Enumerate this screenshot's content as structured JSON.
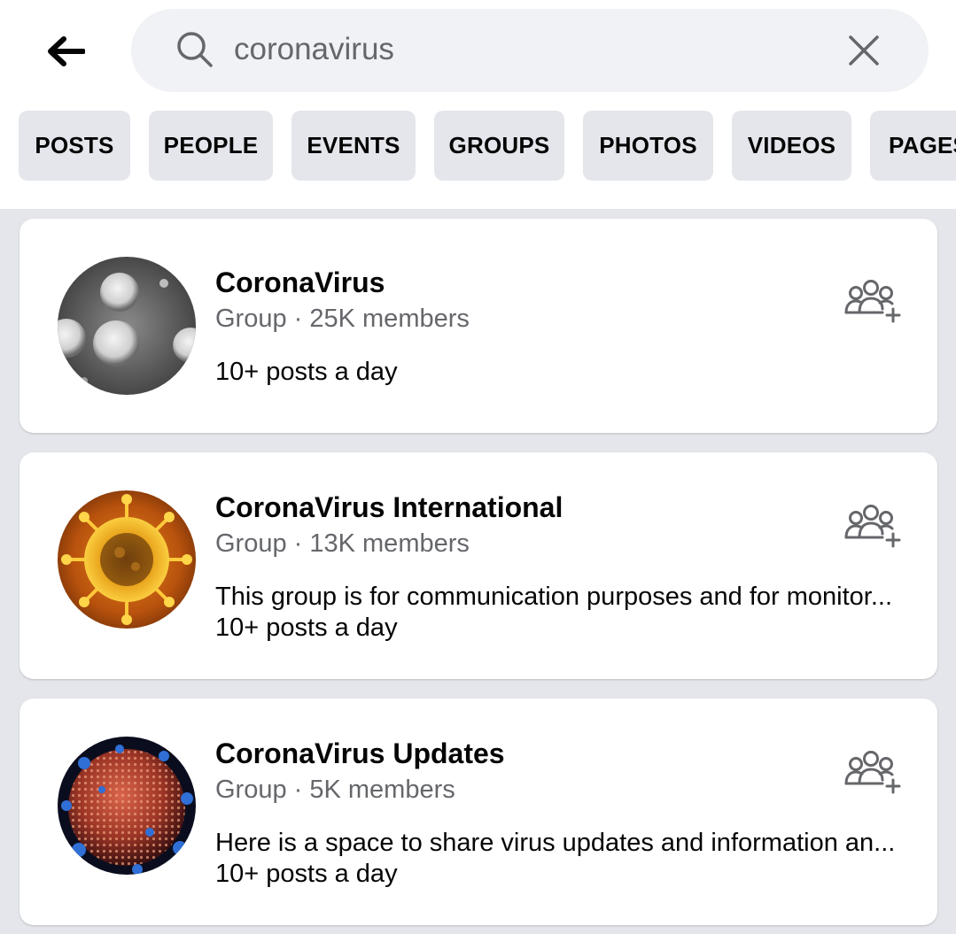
{
  "search": {
    "query": "coronavirus"
  },
  "icons": {
    "back": "back-arrow-icon",
    "search": "search-icon",
    "clear": "close-icon",
    "join": "join-group-icon"
  },
  "tabs": [
    {
      "label": "POSTS"
    },
    {
      "label": "PEOPLE"
    },
    {
      "label": "EVENTS"
    },
    {
      "label": "GROUPS"
    },
    {
      "label": "PHOTOS"
    },
    {
      "label": "VIDEOS"
    },
    {
      "label": "PAGES"
    }
  ],
  "results": [
    {
      "name": "CoronaVirus",
      "meta": "Group · 25K members",
      "description": "",
      "activity": "10+ posts a day"
    },
    {
      "name": "CoronaVirus International",
      "meta": "Group · 13K members",
      "description": "This group is for communication purposes and for monitor...",
      "activity": "10+ posts a day"
    },
    {
      "name": "CoronaVirus Updates",
      "meta": "Group · 5K members",
      "description": "Here is a space to share virus updates and information an...",
      "activity": "10+ posts a day"
    }
  ],
  "colors": {
    "background": "#e4e6eb",
    "card": "#ffffff",
    "secondary_text": "#65676b",
    "primary_text": "#050505"
  }
}
